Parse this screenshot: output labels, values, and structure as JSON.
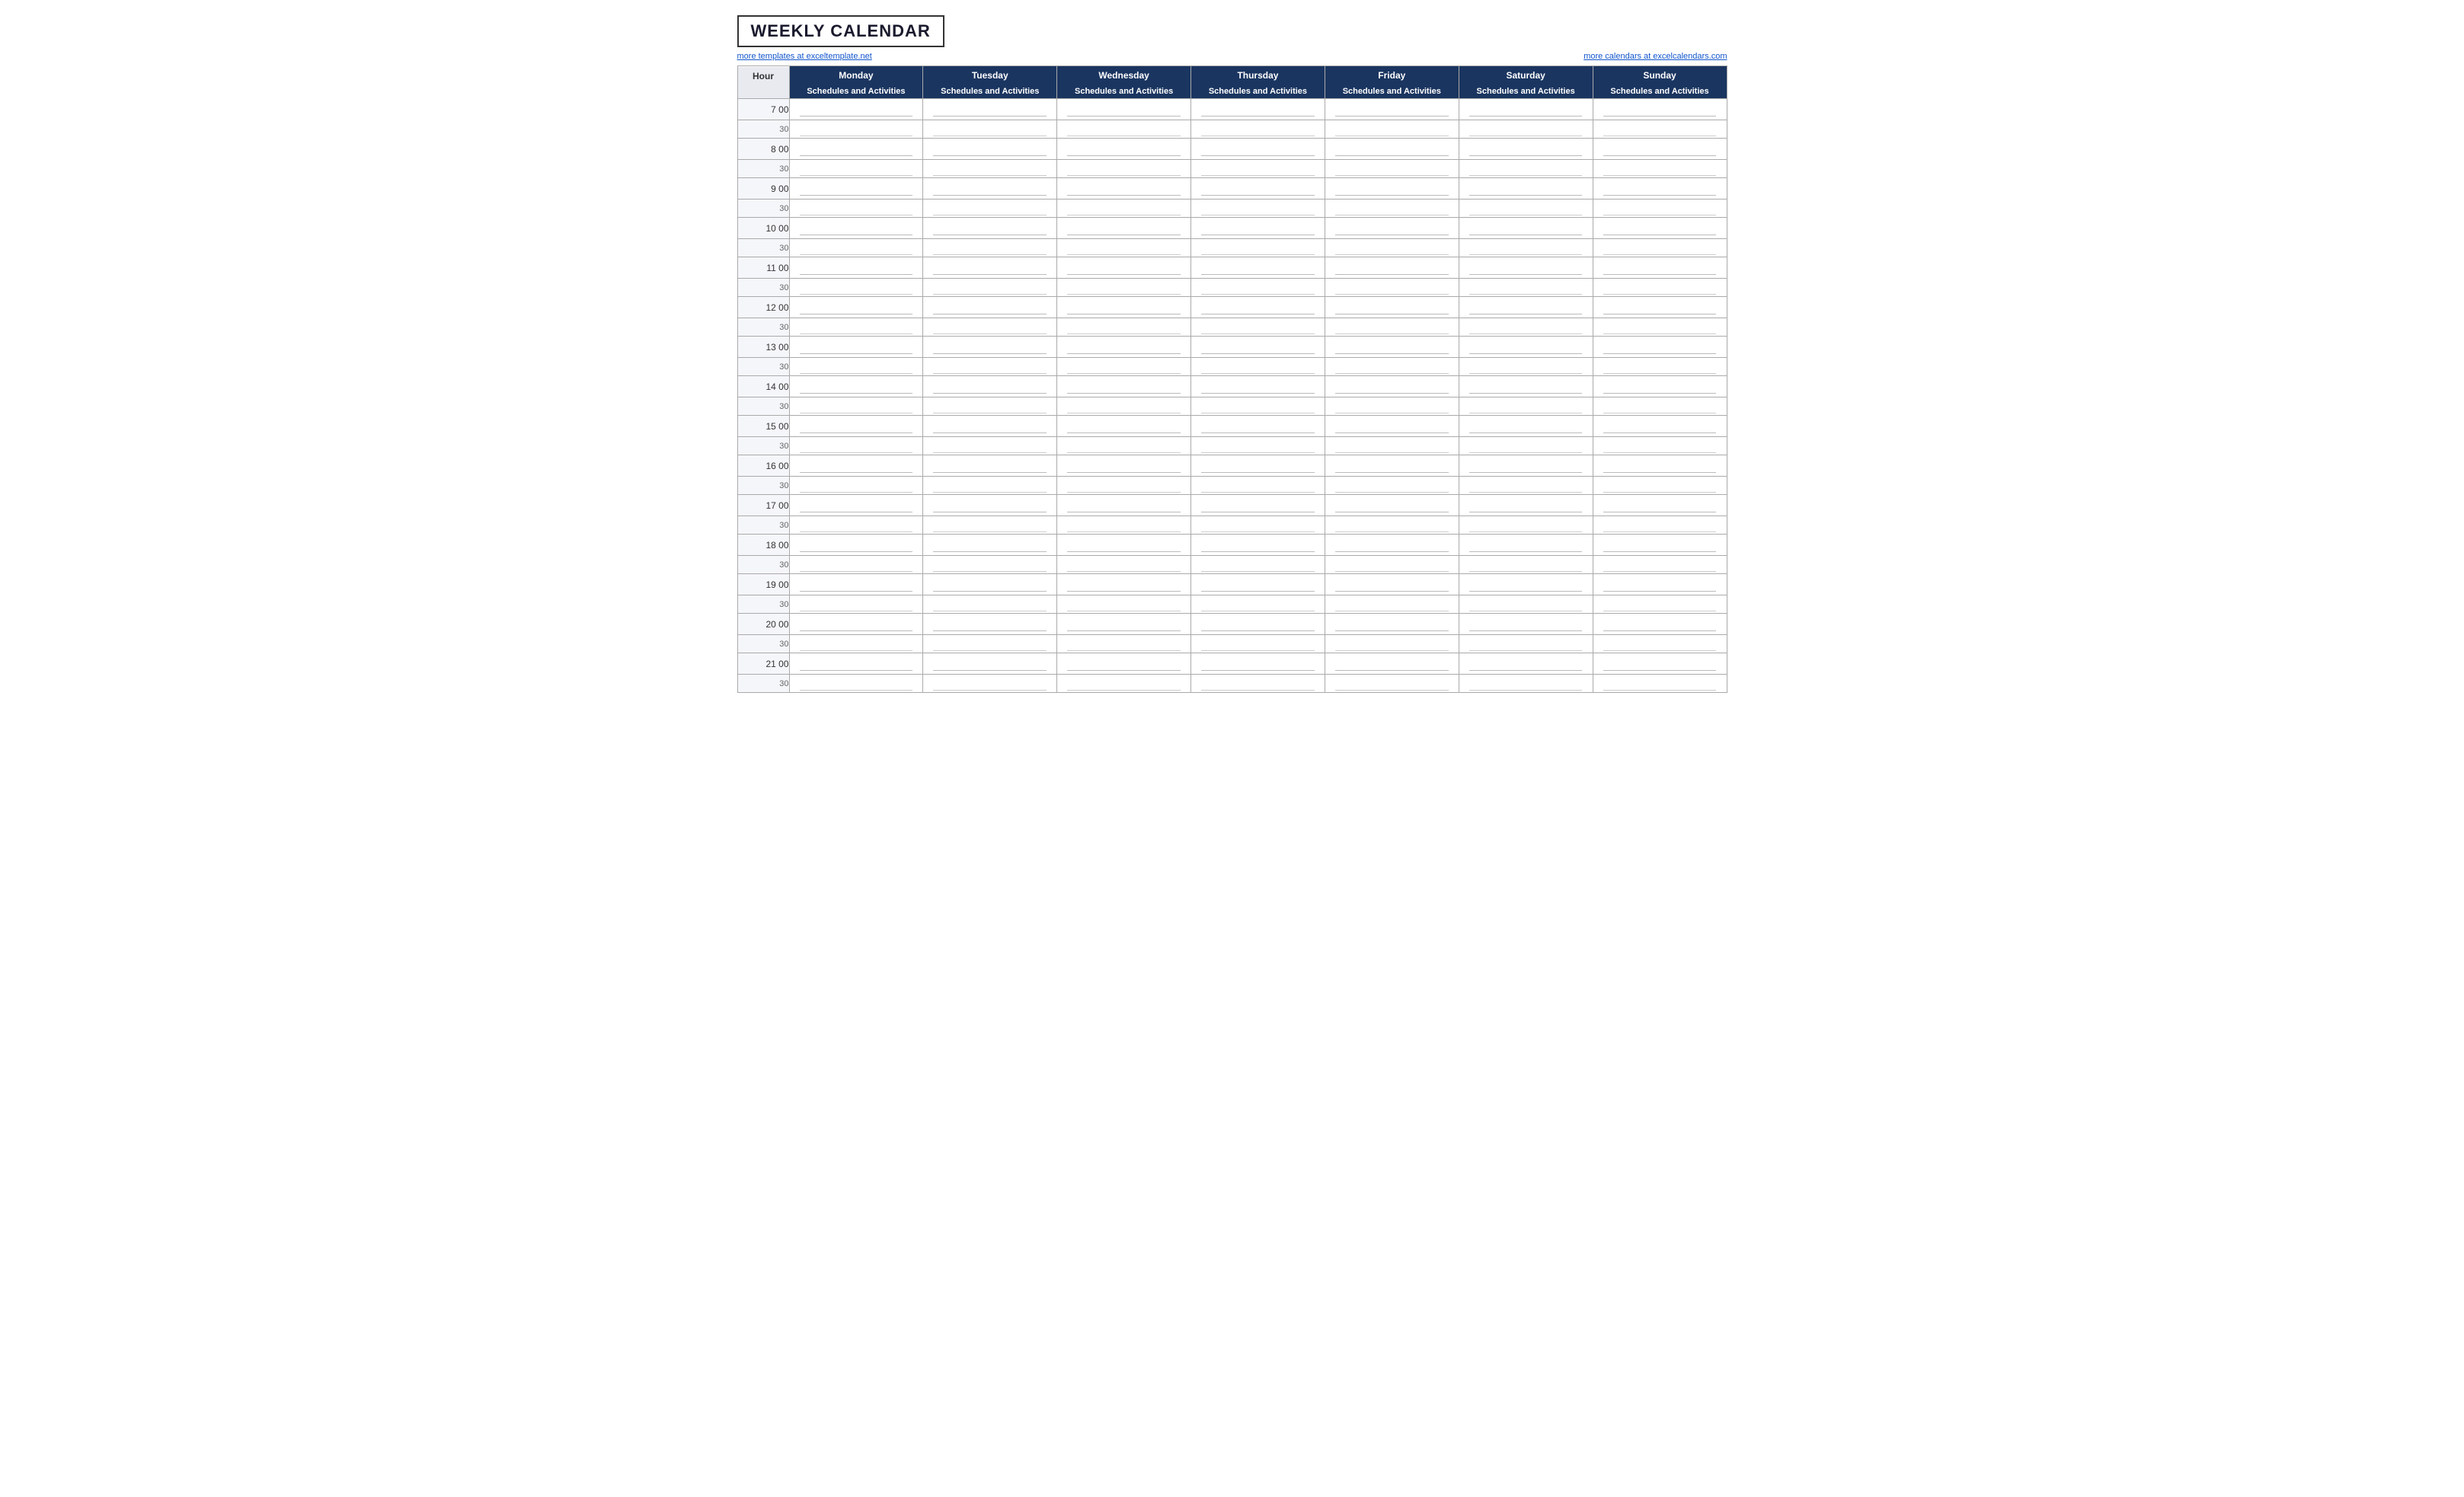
{
  "title": "WEEKLY CALENDAR",
  "link_left": "more templates at exceltemplate.net",
  "link_right": "more calendars at excelcalendars.com",
  "hour_header": "Hour",
  "days": [
    {
      "label": "Monday",
      "sub": "Schedules and Activities"
    },
    {
      "label": "Tuesday",
      "sub": "Schedules and Activities"
    },
    {
      "label": "Wednesday",
      "sub": "Schedules and Activities"
    },
    {
      "label": "Thursday",
      "sub": "Schedules and Activities"
    },
    {
      "label": "Friday",
      "sub": "Schedules and Activities"
    },
    {
      "label": "Saturday",
      "sub": "Schedules and Activities"
    },
    {
      "label": "Sunday",
      "sub": "Schedules and Activities"
    }
  ],
  "time_slots": [
    {
      "hour": "7  00",
      "half": "30"
    },
    {
      "hour": "8  00",
      "half": "30"
    },
    {
      "hour": "9  00",
      "half": "30"
    },
    {
      "hour": "10  00",
      "half": "30"
    },
    {
      "hour": "11  00",
      "half": "30"
    },
    {
      "hour": "12  00",
      "half": "30"
    },
    {
      "hour": "13  00",
      "half": "30"
    },
    {
      "hour": "14  00",
      "half": "30"
    },
    {
      "hour": "15  00",
      "half": "30"
    },
    {
      "hour": "16  00",
      "half": "30"
    },
    {
      "hour": "17  00",
      "half": "30"
    },
    {
      "hour": "18  00",
      "half": "30"
    },
    {
      "hour": "19  00",
      "half": "30"
    },
    {
      "hour": "20  00",
      "half": "30"
    },
    {
      "hour": "21  00",
      "half": "30"
    }
  ]
}
